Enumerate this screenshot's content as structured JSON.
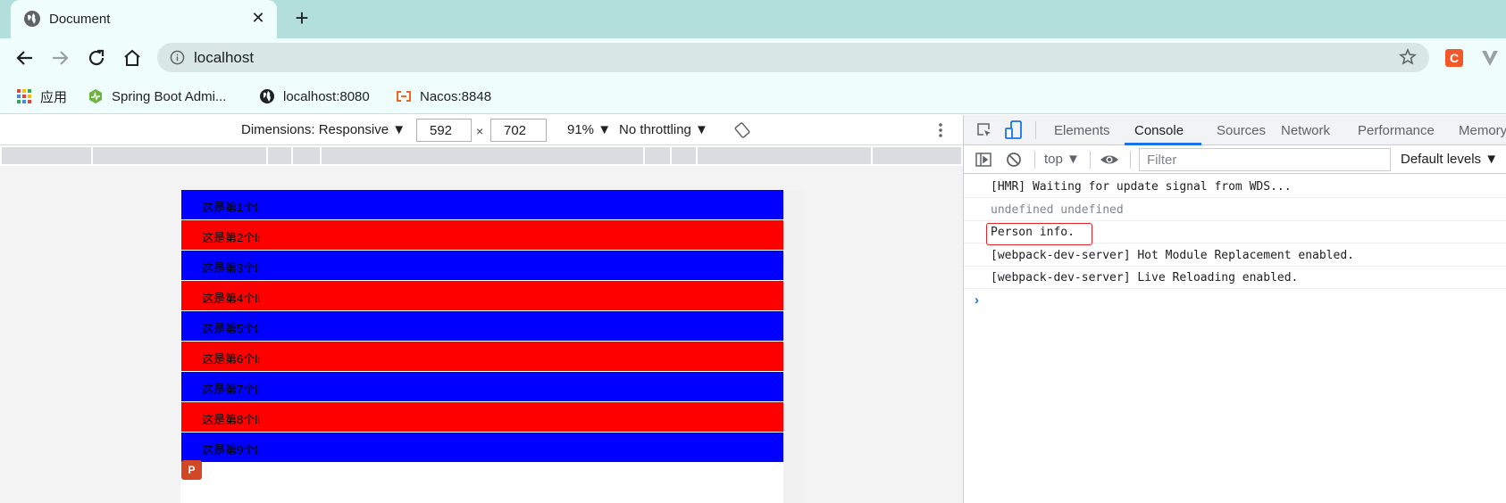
{
  "browser": {
    "tab_title": "Document",
    "url": "localhost",
    "bookmarks": [
      {
        "label": "应用",
        "icon": "apps-grid-icon"
      },
      {
        "label": "Spring Boot Admi...",
        "icon": "spring-boot-admin-icon"
      },
      {
        "label": "localhost:8080",
        "icon": "globe-icon"
      },
      {
        "label": "Nacos:8848",
        "icon": "nacos-icon"
      }
    ],
    "extensions": [
      "C",
      "V"
    ]
  },
  "device_toolbar": {
    "dimensions_label": "Dimensions: Responsive",
    "width": "592",
    "height": "702",
    "x_sign": "×",
    "zoom": "91%",
    "throttling": "No throttling"
  },
  "page": {
    "items": [
      {
        "text": "这是第1个li",
        "color": "#0000ff"
      },
      {
        "text": "这是第2个li",
        "color": "#ff0000"
      },
      {
        "text": "这是第3个li",
        "color": "#0000ff"
      },
      {
        "text": "这是第4个li",
        "color": "#ff0000"
      },
      {
        "text": "这是第5个li",
        "color": "#0000ff"
      },
      {
        "text": "这是第6个li",
        "color": "#ff0000"
      },
      {
        "text": "这是第7个li",
        "color": "#0000ff"
      },
      {
        "text": "这是第8个li",
        "color": "#ff0000"
      },
      {
        "text": "这是第9个li",
        "color": "#0000ff"
      }
    ],
    "ppt_icon_letter": "P"
  },
  "devtools": {
    "tabs": [
      "Elements",
      "Console",
      "Sources",
      "Network",
      "Performance",
      "Memory"
    ],
    "active_tab": "Console",
    "context": "top",
    "filter_placeholder": "Filter",
    "levels": "Default levels",
    "logs": [
      {
        "text": "[HMR] Waiting for update signal from WDS...",
        "muted": false
      },
      {
        "text": "undefined undefined",
        "muted": true
      },
      {
        "text": "Person info.",
        "muted": false,
        "highlighted": true
      },
      {
        "text": "[webpack-dev-server] Hot Module Replacement enabled.",
        "muted": false
      },
      {
        "text": "[webpack-dev-server] Live Reloading enabled.",
        "muted": false
      }
    ],
    "prompt_symbol": "›"
  },
  "colors": {
    "tab_strip": "#b2dfdc",
    "toolbar": "#f0fdfd",
    "highlight_border": "#e0262a",
    "active_tab_underline": "#1a73e8"
  }
}
